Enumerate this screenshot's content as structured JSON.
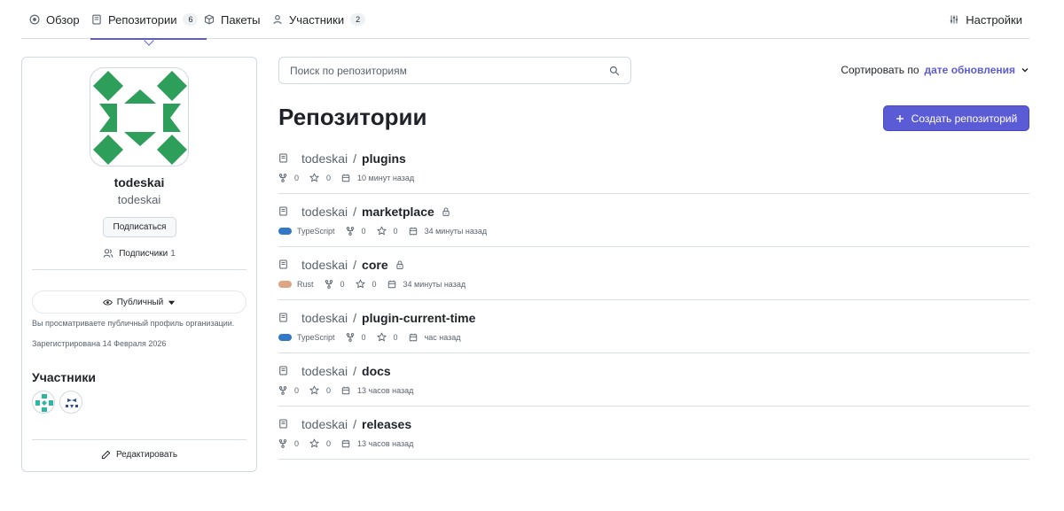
{
  "nav": {
    "tabs": [
      {
        "label": "Обзор",
        "icon": "overview-icon"
      },
      {
        "label": "Репозитории",
        "icon": "repo-icon",
        "count": "6",
        "active": true
      },
      {
        "label": "Пакеты",
        "icon": "package-icon"
      },
      {
        "label": "Участники",
        "icon": "person-icon",
        "count": "2"
      }
    ],
    "settings_label": "Настройки"
  },
  "org": {
    "name": "todeskai",
    "login": "todeskai",
    "follow_label": "Подписаться",
    "followers_label": "Подписчики",
    "followers_count": "1",
    "visibility_label": "Публичный",
    "visibility_note": "Вы просматриваете публичный профиль организации.",
    "registered": "Зарегистрирована 14 Февраля 2026",
    "members_title": "Участники",
    "edit_label": "Редактировать"
  },
  "search": {
    "placeholder": "Поиск по репозиториям"
  },
  "sort": {
    "label": "Сортировать по",
    "value": "дате обновления"
  },
  "page_title": "Репозитории",
  "create_label": "Создать репозиторий",
  "colors": {
    "accent": "#5b5bd6",
    "typescript": "#3178c6",
    "rust": "#dea584"
  },
  "repos": [
    {
      "owner": "todeskai",
      "sep": "/",
      "name": "plugins",
      "private": false,
      "language": "",
      "forks": "0",
      "stars": "0",
      "updated": "10 минут назад"
    },
    {
      "owner": "todeskai",
      "sep": "/",
      "name": "marketplace",
      "private": true,
      "language": "TypeScript",
      "forks": "0",
      "stars": "0",
      "updated": "34 минуты назад"
    },
    {
      "owner": "todeskai",
      "sep": "/",
      "name": "core",
      "private": true,
      "language": "Rust",
      "forks": "0",
      "stars": "0",
      "updated": "34 минуты назад"
    },
    {
      "owner": "todeskai",
      "sep": "/",
      "name": "plugin-current-time",
      "private": false,
      "language": "TypeScript",
      "forks": "0",
      "stars": "0",
      "updated": "час назад"
    },
    {
      "owner": "todeskai",
      "sep": "/",
      "name": "docs",
      "private": false,
      "language": "",
      "forks": "0",
      "stars": "0",
      "updated": "13 часов назад"
    },
    {
      "owner": "todeskai",
      "sep": "/",
      "name": "releases",
      "private": false,
      "language": "",
      "forks": "0",
      "stars": "0",
      "updated": "13 часов назад"
    }
  ]
}
